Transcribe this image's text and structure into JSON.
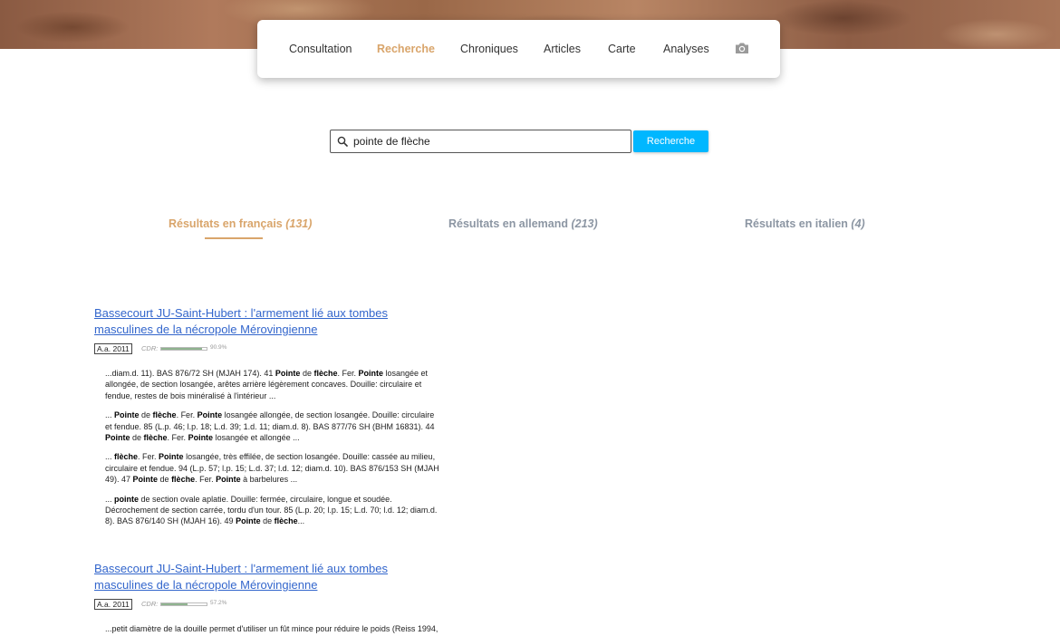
{
  "nav": {
    "items": [
      {
        "label": "Consultation",
        "active": false
      },
      {
        "label": "Recherche",
        "active": true
      },
      {
        "label": "Chroniques",
        "active": false
      },
      {
        "label": "Articles",
        "active": false
      },
      {
        "label": "Carte",
        "active": false
      },
      {
        "label": "Analyses",
        "active": false
      }
    ],
    "camera_icon": "camera-icon"
  },
  "search": {
    "query": "pointe de flèche",
    "button_label": "Recherche",
    "icon": "search-icon"
  },
  "tabs": [
    {
      "label": "Résultats en français",
      "count": "(131)",
      "active": true
    },
    {
      "label": "Résultats en allemand",
      "count": "(213)",
      "active": false
    },
    {
      "label": "Résultats en italien",
      "count": "(4)",
      "active": false
    }
  ],
  "results": [
    {
      "title": "Bassecourt JU-Saint-Hubert : l'armement lié aux tombes masculines de la nécropole Mérovingienne",
      "badge": "A.a. 2011",
      "cdr_label": "CDR:",
      "cdr_value": "90.9%",
      "cdr_fraction": 0.909,
      "snippets": [
        [
          {
            "t": "...diam.d. 11). BAS 876/72 SH (MJAH 174). 41 ",
            "b": false
          },
          {
            "t": "Pointe",
            "b": true
          },
          {
            "t": " de ",
            "b": false
          },
          {
            "t": "flèche",
            "b": true
          },
          {
            "t": ". Fer. ",
            "b": false
          },
          {
            "t": "Pointe",
            "b": true
          },
          {
            "t": " losangée et allongée, de section losangée, arêtes arrière légèrement concaves. Douille: circulaire et fendue, restes de bois minéralisé à l'intérieur ...",
            "b": false
          }
        ],
        [
          {
            "t": "... ",
            "b": false
          },
          {
            "t": "Pointe",
            "b": true
          },
          {
            "t": " de ",
            "b": false
          },
          {
            "t": "flèche",
            "b": true
          },
          {
            "t": ". Fer. ",
            "b": false
          },
          {
            "t": "Pointe",
            "b": true
          },
          {
            "t": " losangée allongée, de section losangée. Douille: circulaire et fendue. 85 (L.p. 46; l.p. 18; L.d. 39; 1.d. 11; diam.d. 8). BAS 877/76 SH (BHM 16831). 44 ",
            "b": false
          },
          {
            "t": "Pointe",
            "b": true
          },
          {
            "t": " de ",
            "b": false
          },
          {
            "t": "flèche",
            "b": true
          },
          {
            "t": ". Fer. ",
            "b": false
          },
          {
            "t": "Pointe",
            "b": true
          },
          {
            "t": " losangée et allongée ...",
            "b": false
          }
        ],
        [
          {
            "t": "... ",
            "b": false
          },
          {
            "t": "flèche",
            "b": true
          },
          {
            "t": ". Fer. ",
            "b": false
          },
          {
            "t": "Pointe",
            "b": true
          },
          {
            "t": " losangée, très effilée, de section losangée. Douille: cassée au milieu, circulaire et fendue. 94 (L.p. 57; l.p. 15; L.d. 37; l.d. 12; diam.d. 10). BAS 876/153 SH (MJAH 49). 47 ",
            "b": false
          },
          {
            "t": "Pointe",
            "b": true
          },
          {
            "t": " de ",
            "b": false
          },
          {
            "t": "flèche",
            "b": true
          },
          {
            "t": ". Fer. ",
            "b": false
          },
          {
            "t": "Pointe",
            "b": true
          },
          {
            "t": " à barbelures ...",
            "b": false
          }
        ],
        [
          {
            "t": "... ",
            "b": false
          },
          {
            "t": "pointe",
            "b": true
          },
          {
            "t": " de section ovale aplatie. Douille: fermée, circulaire, longue et soudée. Décrochement de section carrée, tordu d'un tour. 85 (L.p. 20; l.p. 15; L.d. 70; l.d. 12; diam.d. 8). BAS 876/140 SH (MJAH 16). 49 ",
            "b": false
          },
          {
            "t": "Pointe",
            "b": true
          },
          {
            "t": " de ",
            "b": false
          },
          {
            "t": "flèche",
            "b": true
          },
          {
            "t": "...",
            "b": false
          }
        ]
      ]
    },
    {
      "title": "Bassecourt JU-Saint-Hubert : l'armement lié aux tombes masculines de la nécropole Mérovingienne",
      "badge": "A.a. 2011",
      "cdr_label": "CDR:",
      "cdr_value": "57.2%",
      "cdr_fraction": 0.572,
      "snippets": [
        [
          {
            "t": "...petit diamètre de la douille permet d'utiliser un fût mince pour réduire le poids (Reiss 1994,",
            "b": false
          }
        ]
      ]
    }
  ]
}
